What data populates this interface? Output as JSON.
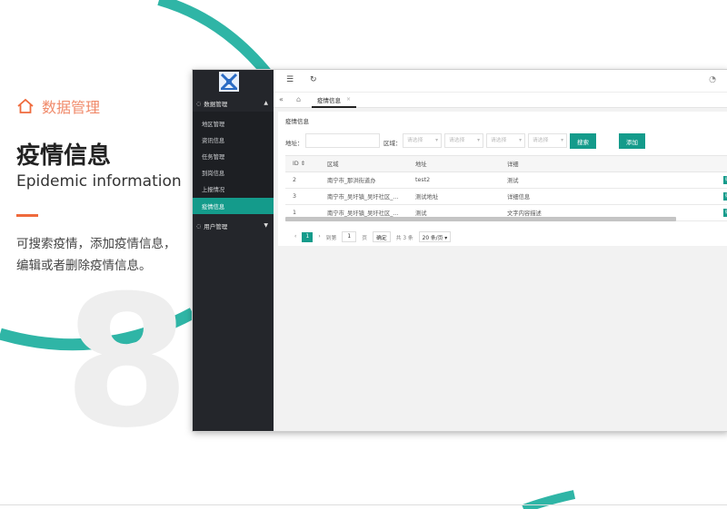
{
  "section_title": "数据管理",
  "page_title_cn": "疫情信息",
  "page_title_en": "Epidemic information",
  "description_line1": "可搜索疫情，添加疫情信息，",
  "description_line2": "编辑或者删除疫情信息。",
  "big_number": "8",
  "colors": {
    "teal": "#149b8b",
    "sidebar": "#24262b",
    "accent_orange": "#ef6a3c",
    "section_title": "#f08a6a"
  },
  "app": {
    "sidebar": {
      "group1": {
        "label": "数据管理",
        "icon": "circle-icon"
      },
      "items": [
        {
          "label": "地区管理"
        },
        {
          "label": "资讯信息"
        },
        {
          "label": "任务管理"
        },
        {
          "label": "到岗信息"
        },
        {
          "label": "上报情况"
        },
        {
          "label": "疫情信息",
          "active": true
        }
      ],
      "group2": {
        "label": "用户管理",
        "icon": "circle-icon"
      }
    },
    "topbar": {
      "menu_icon": "menu-toggle-icon",
      "refresh_icon": "refresh-icon",
      "theme_icon": "palette-icon"
    },
    "tabs": {
      "collapse": "«",
      "home_icon": "home-icon",
      "active_tab": "疫情信息",
      "close": "×"
    },
    "panel_title": "疫情信息",
    "filter": {
      "address_label": "地址：",
      "address_value": "",
      "area_label": "区域：",
      "selects": [
        "请选择",
        "请选择",
        "请选择",
        "请选择"
      ],
      "search_button": "搜索",
      "add_button": "添加"
    },
    "table": {
      "headers": [
        "ID ⇕",
        "区域",
        "地址",
        "详细"
      ],
      "rows": [
        {
          "id": "2",
          "area": "南宁市_那洪街道办",
          "address": "test2",
          "detail": "测试"
        },
        {
          "id": "3",
          "area": "南宁市_吴圩镇_吴圩社区_...",
          "address": "测试地址",
          "detail": "详细信息"
        },
        {
          "id": "1",
          "area": "南宁市_吴圩镇_吴圩社区_...",
          "address": "测试",
          "detail": "文字内容描述"
        }
      ],
      "edit_label": "编辑"
    },
    "pager": {
      "prev": "‹",
      "current_page": "1",
      "next": "›",
      "goto_label": "到第",
      "goto_value": "1",
      "page_suffix": "页",
      "confirm": "确定",
      "total": "共 3 条",
      "page_size": "20 条/页 ▾"
    }
  }
}
